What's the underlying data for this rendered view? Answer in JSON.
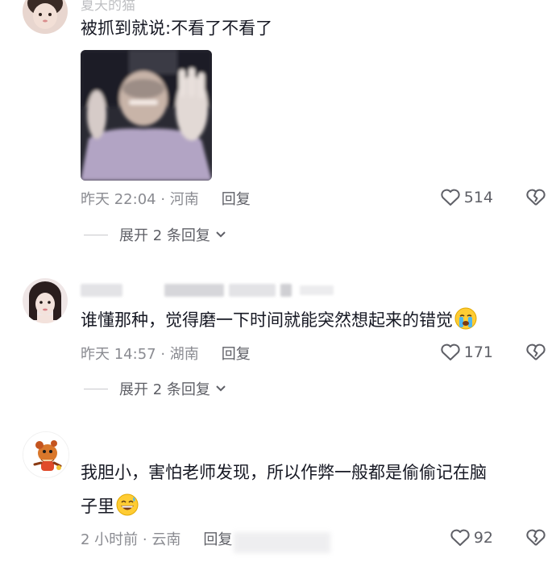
{
  "comments": [
    {
      "username": "夏天的猫",
      "text": "被抓到就说:不看了不看了",
      "time_location": "昨天 22:04 · 河南",
      "reply_label": "回复",
      "likes": "514",
      "expand_label": "展开 2 条回复",
      "has_image": true
    },
    {
      "username": "",
      "text": "谁懂那种，觉得磨一下时间就能突然想起来的错觉",
      "emoji": "loudly-crying-face",
      "time_location": "昨天 14:57 · 湖南",
      "reply_label": "回复",
      "likes": "171",
      "expand_label": "展开 2 条回复"
    },
    {
      "username": "",
      "text_line1": "我胆小，害怕老师发现，所以作弊一般都是偷偷记在脑",
      "text_line2": "子里",
      "emoji": "grinning-sweat-face",
      "time_location": "2 小时前 · 云南",
      "reply_label": "回复",
      "likes": "92"
    }
  ],
  "colors": {
    "text": "#161823",
    "meta": "#8a8b91",
    "accent_icon": "#5e5f66"
  }
}
